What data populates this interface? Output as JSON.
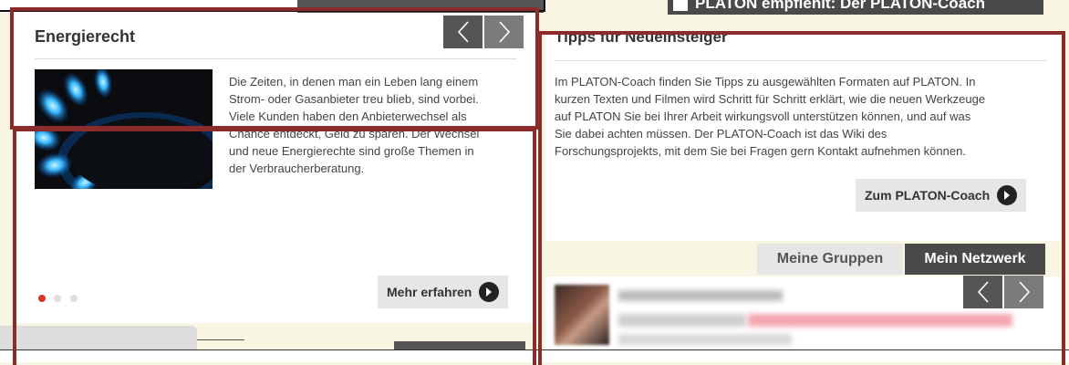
{
  "left_card": {
    "title": "Energierecht",
    "text": "Die Zeiten, in denen man ein Leben lang einem Strom- oder Gasanbieter treu blieb, sind vorbei. Viele Kunden haben den Anbieterwechsel als Chance entdeckt, Geld zu sparen. Der Wechsel und neue Energierechte sind große Themen in der Verbraucherberatung.",
    "text_lines": [
      "Die Zeiten, in denen man ein Leben lang einem",
      "Strom- oder Gasanbieter treu blieb, sind vorbei.",
      "Viele Kunden haben den Anbieterwechsel als",
      "Chance entdeckt, Geld zu sparen. Der Wechsel",
      "und neue Energierechte sind große Themen in",
      "der Verbraucherberatung."
    ],
    "more_label": "Mehr erfahren",
    "dots": [
      "active",
      "inactive",
      "inactive"
    ]
  },
  "right_panel": {
    "banner": "PLATON empfiehlt: Der PLATON-Coach",
    "heading": "Tipps für Neueinsteiger",
    "text_lines": [
      "Im PLATON-Coach finden Sie Tipps zu ausgewählten Formaten auf PLATON. In",
      "kurzen Texten und Filmen wird Schritt für Schritt erklärt, wie die neuen Werkzeuge",
      "auf PLATON Sie bei Ihrer Arbeit wirkungsvoll unterstützen können, und auf was",
      "Sie dabei achten müssen. Der PLATON-Coach ist das Wiki des",
      "Forschungsprojekts, mit dem Sie bei Fragen gern Kontakt aufnehmen können."
    ],
    "coach_button": "Zum PLATON-Coach",
    "tabs": [
      "Meine Gruppen",
      "Mein Netzwerk"
    ]
  },
  "colors": {
    "accent_red": "#8b2b2b",
    "nav_dark": "#555555",
    "dot_active": "#d9342b"
  }
}
